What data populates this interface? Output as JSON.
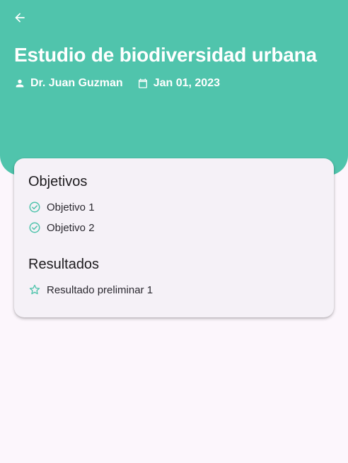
{
  "header": {
    "title": "Estudio de biodiversidad urbana",
    "author": "Dr. Juan Guzman",
    "date": "Jan 01, 2023",
    "icons": {
      "back": "arrow-back-icon",
      "author": "person-icon",
      "date": "calendar-icon"
    }
  },
  "colors": {
    "accent": "#50c4ac",
    "background": "#fcf6fc",
    "card": "#f5f1f7"
  },
  "card": {
    "objectives": {
      "heading": "Objetivos",
      "items": [
        "Objetivo 1",
        "Objetivo 2"
      ],
      "icon": "check-circle-icon"
    },
    "results": {
      "heading": "Resultados",
      "items": [
        "Resultado preliminar 1"
      ],
      "icon": "star-outline-icon"
    }
  }
}
